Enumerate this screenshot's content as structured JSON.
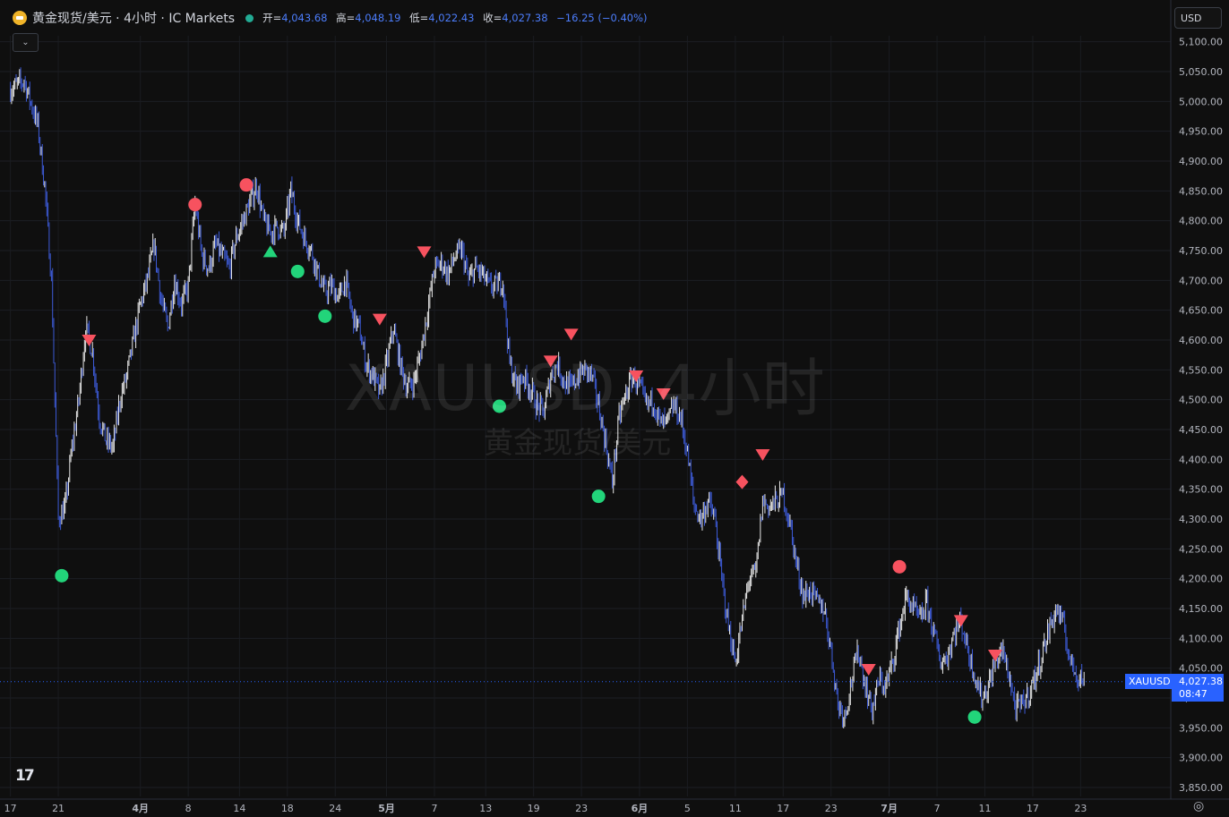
{
  "header": {
    "title": "黄金现货/美元 · 4小时 · IC Markets",
    "ohlc": {
      "open_label": "开=",
      "open": "4,043.68",
      "high_label": "高=",
      "high": "4,048.19",
      "low_label": "低=",
      "low": "4,022.43",
      "close_label": "收=",
      "close": "4,027.38",
      "change": "−16.25 (−0.40%)"
    }
  },
  "toolbar": {
    "currency": "USD",
    "currency_icon": "chevron-down-icon",
    "collapse_icon": "chevron-down-icon"
  },
  "watermark": {
    "symbol": "XAUUSD, 4小时",
    "name": "黄金现货/美元"
  },
  "last_price": {
    "symbol": "XAUUSD",
    "price": "4,027.38",
    "countdown": "08:47",
    "value": 4027.38
  },
  "colors": {
    "background": "#0f0f0f",
    "candle": "#3d5bd8",
    "candle_wick": "#e8e8e8",
    "sell_signal": "#f7525f",
    "buy_signal": "#22d47a",
    "price_tag": "#2962ff",
    "axis_text": "#b2b5be"
  },
  "chart_data": {
    "type": "candlestick",
    "symbol": "XAUUSD",
    "timeframe": "4小时",
    "y_axis": {
      "ticks": [
        "5,100.00",
        "5,050.00",
        "5,000.00",
        "4,950.00",
        "4,900.00",
        "4,850.00",
        "4,800.00",
        "4,750.00",
        "4,700.00",
        "4,650.00",
        "4,600.00",
        "4,550.00",
        "4,500.00",
        "4,450.00",
        "4,400.00",
        "4,350.00",
        "4,300.00",
        "4,250.00",
        "4,200.00",
        "4,150.00",
        "4,100.00",
        "4,050.00",
        "4,000.00",
        "3,950.00",
        "3,900.00",
        "3,850.00"
      ],
      "tick_values": [
        5100,
        5050,
        5000,
        4950,
        4900,
        4850,
        4800,
        4750,
        4700,
        4650,
        4600,
        4550,
        4500,
        4450,
        4400,
        4350,
        4300,
        4250,
        4200,
        4150,
        4100,
        4050,
        4000,
        3950,
        3900,
        3850
      ],
      "ylim": [
        3835,
        5110
      ]
    },
    "x_axis": {
      "labels": [
        "17",
        "21",
        "4月",
        "8",
        "14",
        "18",
        "24",
        "5月",
        "7",
        "13",
        "19",
        "23",
        "6月",
        "5",
        "11",
        "17",
        "23",
        "7月",
        "7",
        "11",
        "17",
        "23"
      ],
      "label_index": [
        0,
        14,
        38,
        52,
        67,
        81,
        95,
        110,
        124,
        139,
        153,
        167,
        184,
        198,
        212,
        226,
        240,
        257,
        271,
        285,
        299,
        313
      ],
      "xlim": [
        -2,
        337
      ]
    },
    "price_path": [
      [
        0,
        5020
      ],
      [
        4,
        5035
      ],
      [
        8,
        4960
      ],
      [
        10,
        4860
      ],
      [
        12,
        4700
      ],
      [
        14,
        4300
      ],
      [
        16,
        4320
      ],
      [
        18,
        4420
      ],
      [
        20,
        4500
      ],
      [
        22,
        4620
      ],
      [
        24,
        4580
      ],
      [
        26,
        4470
      ],
      [
        28,
        4430
      ],
      [
        30,
        4420
      ],
      [
        32,
        4500
      ],
      [
        34,
        4540
      ],
      [
        36,
        4600
      ],
      [
        38,
        4660
      ],
      [
        40,
        4700
      ],
      [
        42,
        4760
      ],
      [
        44,
        4670
      ],
      [
        46,
        4620
      ],
      [
        48,
        4700
      ],
      [
        50,
        4660
      ],
      [
        52,
        4690
      ],
      [
        54,
        4830
      ],
      [
        56,
        4740
      ],
      [
        58,
        4720
      ],
      [
        60,
        4760
      ],
      [
        62,
        4740
      ],
      [
        64,
        4720
      ],
      [
        66,
        4770
      ],
      [
        68,
        4800
      ],
      [
        70,
        4830
      ],
      [
        72,
        4860
      ],
      [
        74,
        4800
      ],
      [
        76,
        4780
      ],
      [
        78,
        4790
      ],
      [
        80,
        4780
      ],
      [
        82,
        4850
      ],
      [
        84,
        4800
      ],
      [
        86,
        4770
      ],
      [
        88,
        4750
      ],
      [
        90,
        4710
      ],
      [
        92,
        4680
      ],
      [
        94,
        4690
      ],
      [
        96,
        4670
      ],
      [
        98,
        4700
      ],
      [
        100,
        4640
      ],
      [
        102,
        4620
      ],
      [
        104,
        4560
      ],
      [
        106,
        4540
      ],
      [
        108,
        4510
      ],
      [
        110,
        4560
      ],
      [
        112,
        4620
      ],
      [
        114,
        4560
      ],
      [
        116,
        4520
      ],
      [
        118,
        4530
      ],
      [
        120,
        4580
      ],
      [
        122,
        4650
      ],
      [
        124,
        4720
      ],
      [
        126,
        4730
      ],
      [
        128,
        4710
      ],
      [
        130,
        4740
      ],
      [
        132,
        4750
      ],
      [
        134,
        4700
      ],
      [
        136,
        4720
      ],
      [
        138,
        4710
      ],
      [
        140,
        4690
      ],
      [
        142,
        4690
      ],
      [
        144,
        4700
      ],
      [
        146,
        4560
      ],
      [
        148,
        4520
      ],
      [
        150,
        4540
      ],
      [
        152,
        4520
      ],
      [
        154,
        4490
      ],
      [
        156,
        4480
      ],
      [
        158,
        4540
      ],
      [
        160,
        4560
      ],
      [
        162,
        4530
      ],
      [
        164,
        4520
      ],
      [
        166,
        4540
      ],
      [
        168,
        4550
      ],
      [
        170,
        4540
      ],
      [
        172,
        4490
      ],
      [
        174,
        4430
      ],
      [
        176,
        4360
      ],
      [
        178,
        4470
      ],
      [
        180,
        4510
      ],
      [
        182,
        4540
      ],
      [
        184,
        4520
      ],
      [
        186,
        4490
      ],
      [
        188,
        4500
      ],
      [
        190,
        4460
      ],
      [
        192,
        4460
      ],
      [
        194,
        4490
      ],
      [
        196,
        4470
      ],
      [
        198,
        4410
      ],
      [
        200,
        4320
      ],
      [
        202,
        4300
      ],
      [
        204,
        4330
      ],
      [
        206,
        4300
      ],
      [
        208,
        4200
      ],
      [
        210,
        4120
      ],
      [
        212,
        4060
      ],
      [
        214,
        4130
      ],
      [
        216,
        4200
      ],
      [
        218,
        4210
      ],
      [
        220,
        4330
      ],
      [
        222,
        4320
      ],
      [
        224,
        4330
      ],
      [
        226,
        4340
      ],
      [
        228,
        4290
      ],
      [
        230,
        4220
      ],
      [
        232,
        4170
      ],
      [
        234,
        4180
      ],
      [
        236,
        4160
      ],
      [
        238,
        4150
      ],
      [
        240,
        4080
      ],
      [
        242,
        3990
      ],
      [
        244,
        3970
      ],
      [
        246,
        4030
      ],
      [
        248,
        4080
      ],
      [
        250,
        4020
      ],
      [
        252,
        3980
      ],
      [
        254,
        4030
      ],
      [
        256,
        4020
      ],
      [
        258,
        4060
      ],
      [
        260,
        4120
      ],
      [
        262,
        4170
      ],
      [
        264,
        4150
      ],
      [
        266,
        4130
      ],
      [
        268,
        4160
      ],
      [
        270,
        4110
      ],
      [
        272,
        4060
      ],
      [
        274,
        4070
      ],
      [
        276,
        4110
      ],
      [
        278,
        4130
      ],
      [
        280,
        4080
      ],
      [
        282,
        4040
      ],
      [
        284,
        4000
      ],
      [
        286,
        4020
      ],
      [
        288,
        4060
      ],
      [
        290,
        4080
      ],
      [
        292,
        4040
      ],
      [
        294,
        3980
      ],
      [
        296,
        3990
      ],
      [
        298,
        4010
      ],
      [
        300,
        4040
      ],
      [
        302,
        4080
      ],
      [
        304,
        4120
      ],
      [
        306,
        4150
      ],
      [
        308,
        4120
      ],
      [
        310,
        4060
      ],
      [
        312,
        4040
      ],
      [
        314,
        4030
      ]
    ],
    "last_close": 4027.38,
    "signals": [
      {
        "type": "buy-circle",
        "x": 15,
        "y": 4205
      },
      {
        "type": "sell-triangle",
        "x": 23,
        "y": 4600
      },
      {
        "type": "sell-circle",
        "x": 54,
        "y": 4827
      },
      {
        "type": "sell-circle",
        "x": 69,
        "y": 4860
      },
      {
        "type": "buy-triangle",
        "x": 76,
        "y": 4748
      },
      {
        "type": "buy-circle",
        "x": 84,
        "y": 4715
      },
      {
        "type": "buy-circle",
        "x": 92,
        "y": 4640
      },
      {
        "type": "sell-triangle",
        "x": 108,
        "y": 4635
      },
      {
        "type": "sell-triangle",
        "x": 121,
        "y": 4748
      },
      {
        "type": "buy-circle",
        "x": 143,
        "y": 4489
      },
      {
        "type": "sell-triangle",
        "x": 158,
        "y": 4565
      },
      {
        "type": "sell-triangle",
        "x": 164,
        "y": 4610
      },
      {
        "type": "buy-circle",
        "x": 172,
        "y": 4338
      },
      {
        "type": "sell-triangle",
        "x": 183,
        "y": 4540
      },
      {
        "type": "sell-triangle",
        "x": 191,
        "y": 4510
      },
      {
        "type": "sell-diamond",
        "x": 214,
        "y": 4362
      },
      {
        "type": "sell-triangle",
        "x": 220,
        "y": 4408
      },
      {
        "type": "sell-triangle",
        "x": 251,
        "y": 4048
      },
      {
        "type": "sell-circle",
        "x": 260,
        "y": 4220
      },
      {
        "type": "sell-triangle",
        "x": 278,
        "y": 4130
      },
      {
        "type": "buy-circle",
        "x": 282,
        "y": 3968
      },
      {
        "type": "sell-triangle",
        "x": 288,
        "y": 4072
      }
    ]
  }
}
